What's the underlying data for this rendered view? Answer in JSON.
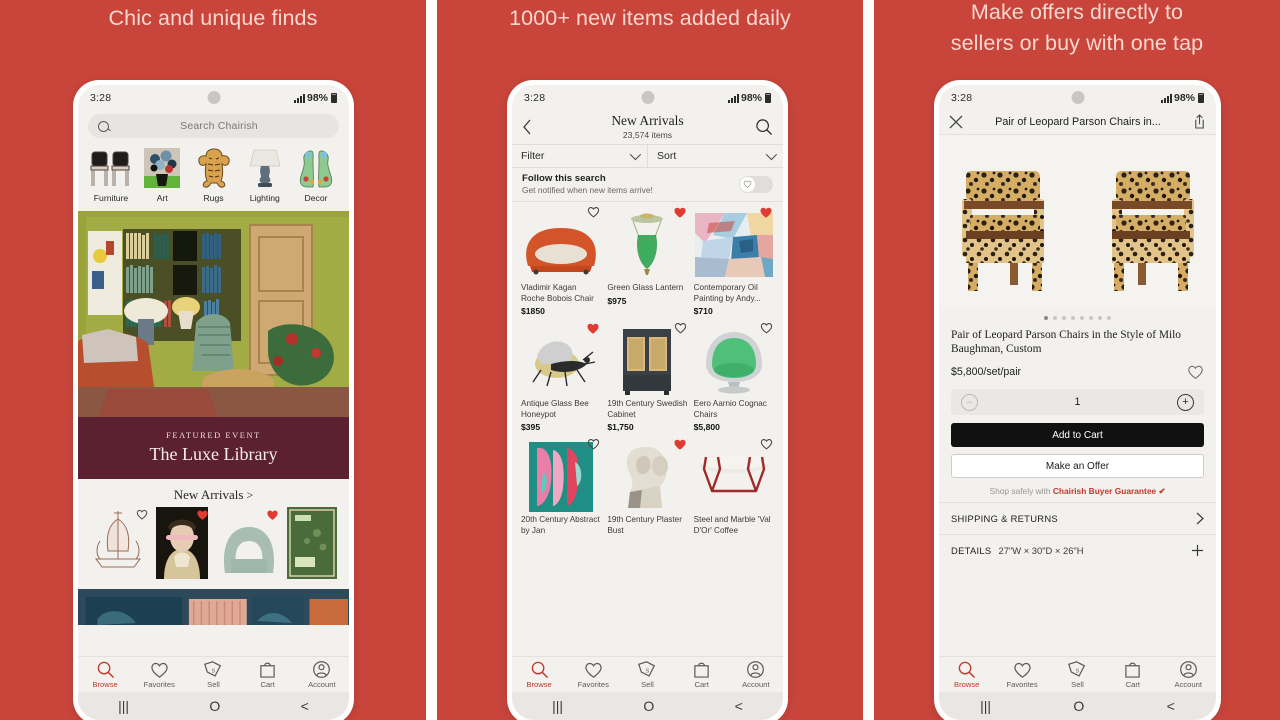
{
  "theme": {
    "background_red": "#C9453B",
    "headline_color": "#F6D8CF",
    "accent_red": "#C0392B",
    "plum": "#5B2133",
    "dark_blue": "#2C4A5C"
  },
  "panels": [
    {
      "headline": "Chic and unique finds",
      "status": {
        "time": "3:28",
        "battery": "98%"
      },
      "search": {
        "placeholder": "Search Chairish",
        "icon": "search-icon"
      },
      "categories": [
        {
          "label": "Furniture",
          "icon": "chairs-thumb"
        },
        {
          "label": "Art",
          "icon": "painting-thumb"
        },
        {
          "label": "Rugs",
          "icon": "tiger-rug-thumb"
        },
        {
          "label": "Lighting",
          "icon": "lamp-thumb"
        },
        {
          "label": "Decor",
          "icon": "parrots-thumb"
        }
      ],
      "hero": {
        "kicker": "FEATURED EVENT",
        "title": "The Luxe Library"
      },
      "new_arrivals": {
        "label": "New Arrivals",
        "chevron": ">"
      },
      "new_arrival_cards": [
        {
          "name": "ship-drawing",
          "favorited": false
        },
        {
          "name": "portrait-painting",
          "favorited": true
        },
        {
          "name": "sage-armchair",
          "favorited": true
        },
        {
          "name": "green-artwork",
          "favorited": false
        }
      ],
      "tabs": [
        {
          "label": "Browse",
          "icon": "search-icon",
          "active": true
        },
        {
          "label": "Favorites",
          "icon": "heart-icon",
          "active": false
        },
        {
          "label": "Sell",
          "icon": "tag-icon",
          "active": false
        },
        {
          "label": "Cart",
          "icon": "bag-icon",
          "active": false
        },
        {
          "label": "Account",
          "icon": "person-icon",
          "active": false
        }
      ],
      "sysnav": {
        "recents": "|||",
        "home": "O",
        "back": "<"
      }
    },
    {
      "headline": "1000+ new items added daily",
      "status": {
        "time": "3:28",
        "battery": "98%"
      },
      "header": {
        "back_icon": "chevron-left-icon",
        "title": "New Arrivals",
        "subtitle": "23,574 items",
        "search_icon": "search-icon"
      },
      "filters": [
        {
          "label": "Filter",
          "icon": "chevron-down-icon"
        },
        {
          "label": "Sort",
          "icon": "chevron-down-icon"
        }
      ],
      "follow": {
        "title": "Follow this search",
        "subtitle": "Get notified when new items arrive!",
        "toggle_on": false,
        "knob_icon": "heart-icon"
      },
      "products": [
        {
          "title": "Vladimir Kagan Roche Bobois Chair",
          "price": "$1850",
          "favorited": false,
          "image": "orange-velvet-chair"
        },
        {
          "title": "Green Glass Lantern",
          "price": "$975",
          "favorited": true,
          "image": "green-glass-lantern"
        },
        {
          "title": "Contemporary Oil Painting by Andy...",
          "price": "$710",
          "favorited": true,
          "image": "abstract-oil-painting"
        },
        {
          "title": "Antique Glass Bee Honeypot",
          "price": "$395",
          "favorited": true,
          "image": "glass-bee-honeypot"
        },
        {
          "title": "19th Century Swedish Cabinet",
          "price": "$1,750",
          "favorited": false,
          "image": "swedish-cabinet"
        },
        {
          "title": "Eero Aarnio Cognac Chairs",
          "price": "$5,800",
          "favorited": false,
          "image": "eero-aarnio-chair"
        },
        {
          "title": "20th Century Abstract by Jan",
          "price": "",
          "favorited": false,
          "image": "pink-abstract-painting"
        },
        {
          "title": "19th Century Plaster Bust",
          "price": "",
          "favorited": true,
          "image": "plaster-bust"
        },
        {
          "title": "Steel and Marble 'Val D'Or' Coffee",
          "price": "",
          "favorited": false,
          "image": "marble-coffee-table"
        }
      ],
      "tabs": [
        {
          "label": "Browse",
          "icon": "search-icon",
          "active": true
        },
        {
          "label": "Favorites",
          "icon": "heart-icon",
          "active": false
        },
        {
          "label": "Sell",
          "icon": "tag-icon",
          "active": false
        },
        {
          "label": "Cart",
          "icon": "bag-icon",
          "active": false
        },
        {
          "label": "Account",
          "icon": "person-icon",
          "active": false
        }
      ],
      "sysnav": {
        "recents": "|||",
        "home": "O",
        "back": "<"
      }
    },
    {
      "headline": "Make offers directly to\nsellers or buy with one tap",
      "status": {
        "time": "3:28",
        "battery": "98%"
      },
      "header": {
        "close_icon": "close-icon",
        "title": "Pair of Leopard Parson Chairs in...",
        "share_icon": "share-icon"
      },
      "gallery": {
        "image": "leopard-parson-chairs",
        "dot_count": 8,
        "active_dot": 1
      },
      "product": {
        "title": "Pair of Leopard Parson Chairs in the Style of Milo Baughman, Custom",
        "price": "$5,800/set/pair",
        "favorite_icon": "heart-icon",
        "quantity": "1",
        "decrement": "–",
        "increment": "+"
      },
      "buttons": {
        "add_to_cart": "Add to Cart",
        "make_offer": "Make an Offer"
      },
      "guarantee": {
        "prefix": "Shop safely with ",
        "brand": "Chairish Buyer Guarantee",
        "check": "✔"
      },
      "accordions": [
        {
          "label": "SHIPPING & RETURNS",
          "value": "",
          "icon": "chevron-right-icon"
        },
        {
          "label": "DETAILS",
          "value": "27\"W × 30\"D × 26\"H",
          "icon": "plus-icon"
        }
      ],
      "tabs": [
        {
          "label": "Browse",
          "icon": "search-icon",
          "active": true
        },
        {
          "label": "Favorites",
          "icon": "heart-icon",
          "active": false
        },
        {
          "label": "Sell",
          "icon": "tag-icon",
          "active": false
        },
        {
          "label": "Cart",
          "icon": "bag-icon",
          "active": false
        },
        {
          "label": "Account",
          "icon": "person-icon",
          "active": false
        }
      ],
      "sysnav": {
        "recents": "|||",
        "home": "O",
        "back": "<"
      }
    }
  ]
}
